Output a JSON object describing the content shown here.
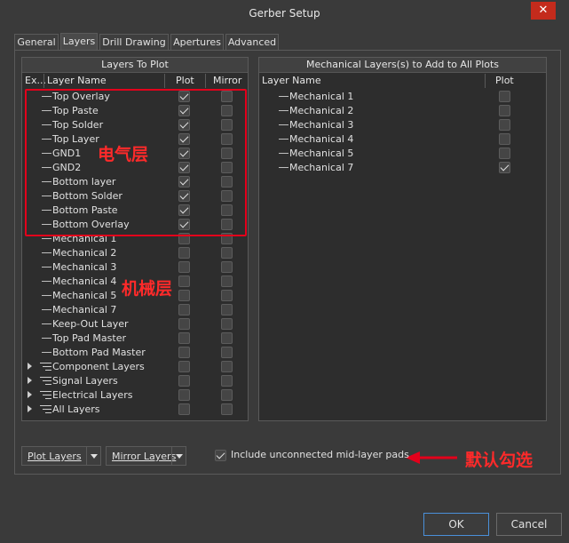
{
  "window": {
    "title": "Gerber Setup",
    "close_glyph": "✕"
  },
  "tabs": [
    "General",
    "Layers",
    "Drill Drawing",
    "Apertures",
    "Advanced"
  ],
  "active_tab": "Layers",
  "left_panel": {
    "title": "Layers To Plot",
    "columns": {
      "expand": "Ex...",
      "layer_name": "Layer Name",
      "plot": "Plot",
      "mirror": "Mirror"
    },
    "rows": [
      {
        "label": "Top Overlay",
        "kind": "leaf",
        "plot": true,
        "mirror": false
      },
      {
        "label": "Top Paste",
        "kind": "leaf",
        "plot": true,
        "mirror": false
      },
      {
        "label": "Top Solder",
        "kind": "leaf",
        "plot": true,
        "mirror": false
      },
      {
        "label": "Top Layer",
        "kind": "leaf",
        "plot": true,
        "mirror": false
      },
      {
        "label": "GND1",
        "kind": "leaf",
        "plot": true,
        "mirror": false
      },
      {
        "label": "GND2",
        "kind": "leaf",
        "plot": true,
        "mirror": false
      },
      {
        "label": "Bottom layer",
        "kind": "leaf",
        "plot": true,
        "mirror": false
      },
      {
        "label": "Bottom Solder",
        "kind": "leaf",
        "plot": true,
        "mirror": false
      },
      {
        "label": "Bottom Paste",
        "kind": "leaf",
        "plot": true,
        "mirror": false
      },
      {
        "label": "Bottom Overlay",
        "kind": "leaf",
        "plot": true,
        "mirror": false
      },
      {
        "label": "Mechanical 1",
        "kind": "leaf",
        "plot": false,
        "mirror": false
      },
      {
        "label": "Mechanical 2",
        "kind": "leaf",
        "plot": false,
        "mirror": false
      },
      {
        "label": "Mechanical 3",
        "kind": "leaf",
        "plot": false,
        "mirror": false
      },
      {
        "label": "Mechanical 4",
        "kind": "leaf",
        "plot": false,
        "mirror": false
      },
      {
        "label": "Mechanical 5",
        "kind": "leaf",
        "plot": false,
        "mirror": false
      },
      {
        "label": "Mechanical 7",
        "kind": "leaf",
        "plot": false,
        "mirror": false
      },
      {
        "label": "Keep-Out Layer",
        "kind": "leaf",
        "plot": false,
        "mirror": false
      },
      {
        "label": "Top Pad Master",
        "kind": "leaf",
        "plot": false,
        "mirror": false
      },
      {
        "label": "Bottom Pad Master",
        "kind": "leaf",
        "plot": false,
        "mirror": false
      },
      {
        "label": "Component Layers",
        "kind": "group",
        "plot": false,
        "mirror": false
      },
      {
        "label": "Signal Layers",
        "kind": "group",
        "plot": false,
        "mirror": false
      },
      {
        "label": "Electrical Layers",
        "kind": "group",
        "plot": false,
        "mirror": false
      },
      {
        "label": "All Layers",
        "kind": "group",
        "plot": false,
        "mirror": false
      }
    ]
  },
  "right_panel": {
    "title": "Mechanical Layers(s) to Add to All Plots",
    "columns": {
      "layer_name": "Layer Name",
      "plot": "Plot"
    },
    "rows": [
      {
        "label": "Mechanical 1",
        "plot": false
      },
      {
        "label": "Mechanical 2",
        "plot": false
      },
      {
        "label": "Mechanical 3",
        "plot": false
      },
      {
        "label": "Mechanical 4",
        "plot": false
      },
      {
        "label": "Mechanical 5",
        "plot": false
      },
      {
        "label": "Mechanical 7",
        "plot": true
      }
    ]
  },
  "annotations": {
    "electrical": "电气层",
    "mechanical": "机械层",
    "default_checked": "默认勾选",
    "color": "#e3001b"
  },
  "bottom": {
    "plot_layers": "Plot Layers",
    "mirror_layers": "Mirror Layers",
    "include_pads_label": "Include unconnected mid-layer pads",
    "include_pads_checked": true
  },
  "footer": {
    "ok": "OK",
    "cancel": "Cancel"
  },
  "colors": {
    "accent": "#4a90d9",
    "close": "#c42b1c"
  },
  "icons": {
    "leaf": "layer-line-icon",
    "group": "layer-stack-icon",
    "expand": "tree-expand-icon",
    "arrow": "red-arrow-icon"
  }
}
